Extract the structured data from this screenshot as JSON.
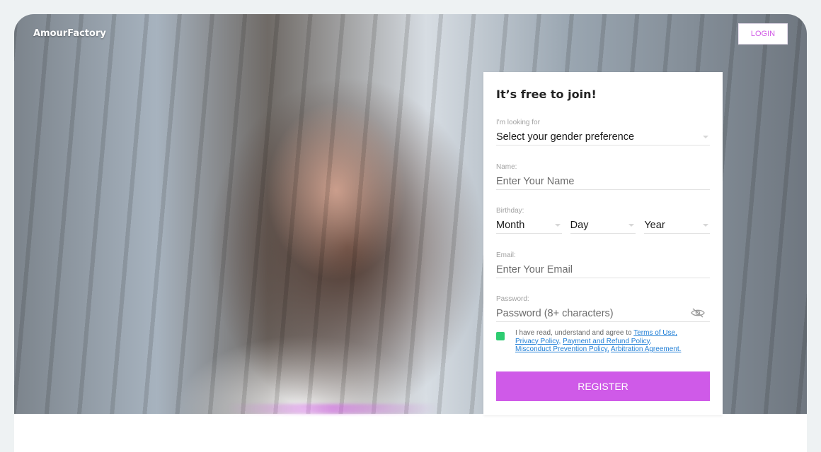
{
  "header": {
    "brand": "AmourFactory",
    "login_label": "LOGIN"
  },
  "form": {
    "title": "It’s free to join!",
    "looking_for": {
      "label": "I'm looking for",
      "value": "Select your gender preference"
    },
    "name": {
      "label": "Name:",
      "placeholder": "Enter Your Name"
    },
    "birthday": {
      "label": "Birthday:",
      "month": "Month",
      "day": "Day",
      "year": "Year"
    },
    "email": {
      "label": "Email:",
      "placeholder": "Enter Your Email"
    },
    "password": {
      "label": "Password:",
      "placeholder": "Password (8+ characters)"
    },
    "consent": {
      "prefix": "I have read, understand and agree to",
      "links": [
        "Terms of Use,",
        "Privacy Policy,",
        "Payment and Refund Policy,",
        "Misconduct Prevention Policy,",
        "Arbitration Agreement."
      ]
    },
    "register_label": "REGISTER"
  },
  "colors": {
    "accent": "#cf5ae8",
    "checkbox": "#2ecc71",
    "link": "#1f7ed6"
  },
  "icons": {
    "password_toggle": "eye-slash-icon",
    "dropdown": "chevron-down-icon"
  }
}
